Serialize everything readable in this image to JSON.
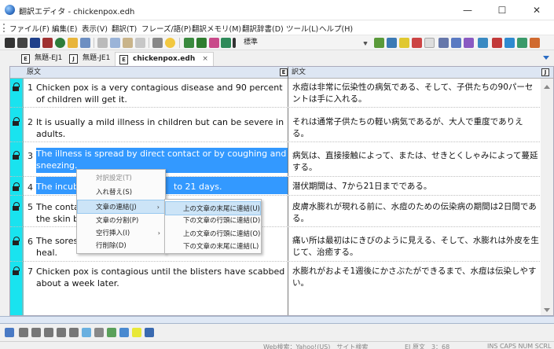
{
  "window": {
    "title": "翻訳エディタ - chickenpox.edh",
    "minimize": "—",
    "maximize": "☐",
    "close": "✕"
  },
  "menu": [
    "ファイル(F)",
    "編集(E)",
    "表示(V)",
    "翻訳(T)",
    "フレーズ/語(P)",
    "翻訳メモリ(M)",
    "翻訳辞書(D)",
    "ツール(L)",
    "ヘルプ(H)"
  ],
  "toolbar": {
    "combo_value": "標準"
  },
  "tabs": [
    {
      "label": "無題-EJ1",
      "icon": "E"
    },
    {
      "label": "無題-JE1",
      "icon": "J"
    },
    {
      "label": "chickenpox.edh",
      "icon": "E",
      "close": "×"
    }
  ],
  "headers": {
    "source": "原文",
    "target": "訳文",
    "source_icon": "E",
    "target_icon": "J"
  },
  "rows": [
    {
      "num": "1",
      "source": "Chicken pox is a very contagious disease and 90 percent of children will get it.",
      "target": "水痘は非常に伝染性の病気である、そして、子供たちの90パーセントは手に入れる。"
    },
    {
      "num": "2",
      "source": "It is usually a mild illness in children but can be severe in adults.",
      "target": "それは通常子供たちの軽い病気であるが、大人で重度でありえる。"
    },
    {
      "num": "3",
      "source": "The illness is spread by direct contact or by coughing and sneezing.",
      "target": "病気は、直接接触によって、または、せきとくしゃみによって蔓延する。"
    },
    {
      "num": "4",
      "source": "The incubation period is from 7 to 21 days.",
      "target": "潜伏期間は、7から21日までである。"
    },
    {
      "num": "5",
      "source": "The contagious period is two days before the rash appears on the skin bl...",
      "target": "皮膚水膨れが現れる前に、水痘のための伝染病の期間は2日間である。"
    },
    {
      "num": "6",
      "source": "The sores ... heal.",
      "target": "痛い所は最初はにきびのように見える、そして、水膨れは外皮を生じて、治癒する。"
    },
    {
      "num": "7",
      "source": "Chicken pox is contagious until the blisters have scabbed about a week later.",
      "target": "水膨れがおよそ1週後にかさぶたができるまで、水痘は伝染しやすい。"
    }
  ],
  "row_display": {
    "r4_visible": "The incuba",
    "r4_tail": "to 21 days.",
    "r5_line1": "The contac",
    "r5_line2": "the skin bl",
    "r6_line1": "The sores",
    "r6_line2": "heal."
  },
  "context_menu": {
    "items": [
      {
        "label": "対訳設定(T)",
        "disabled": true
      },
      {
        "label": "入れ替え(S)"
      },
      {
        "label": "文章の連結(J)",
        "submenu": true
      },
      {
        "label": "文章の分割(P)"
      },
      {
        "label": "空行挿入(I)",
        "submenu": true
      },
      {
        "label": "行削除(D)"
      }
    ],
    "submenu": [
      "上の文章の末尾に連結(U)",
      "下の文章の行頭に連結(D)",
      "上の文章の行頭に連結(O)",
      "下の文章の末尾に連結(L)"
    ],
    "arrow": "›"
  },
  "statusbar": {
    "left": "Web検索：Yahoo!(US)　サイト検索",
    "mid": "EJ 原文　3：68",
    "right": "INS CAPS NUM SCRL"
  },
  "colors": {
    "selection": "#3399ff",
    "cyan_gutter": "#19e3ef",
    "header_bg": "#dde6f3"
  }
}
